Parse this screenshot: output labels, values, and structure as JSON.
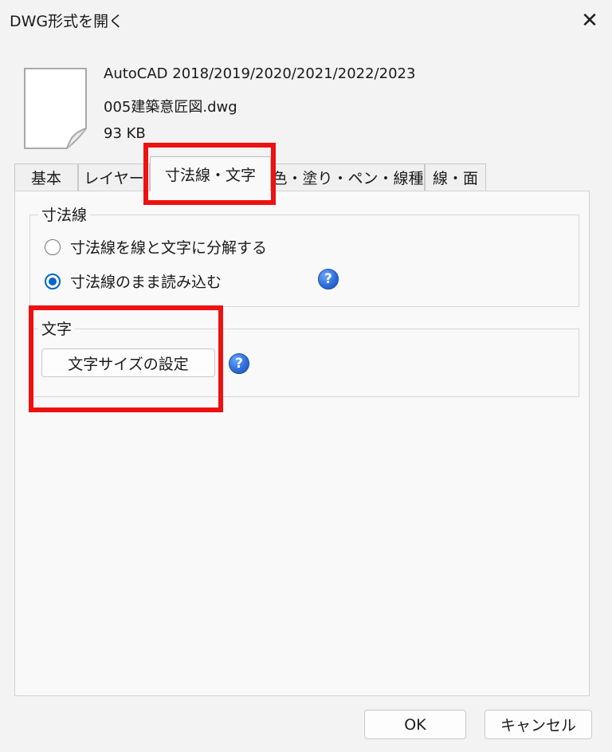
{
  "window": {
    "title": "DWG形式を開く"
  },
  "file": {
    "version": "AutoCAD 2018/2019/2020/2021/2022/2023",
    "name": "005建築意匠図.dwg",
    "size": "93 KB"
  },
  "tabs": [
    {
      "label": "基本"
    },
    {
      "label": "レイヤー"
    },
    {
      "label": "寸法線・文字",
      "active": true
    },
    {
      "label": "色・塗り・ペン・線種"
    },
    {
      "label": "線・面"
    }
  ],
  "dimension_group": {
    "title": "寸法線",
    "options": [
      {
        "label": "寸法線を線と文字に分解する",
        "checked": false
      },
      {
        "label": "寸法線のまま読み込む",
        "checked": true
      }
    ]
  },
  "text_group": {
    "title": "文字",
    "button_label": "文字サイズの設定"
  },
  "footer": {
    "ok_label": "OK",
    "cancel_label": "キャンセル"
  },
  "help_icon_text": "?",
  "close_icon_text": "✕",
  "colors": {
    "accent": "#0067c0",
    "highlight": "#ee1111"
  }
}
